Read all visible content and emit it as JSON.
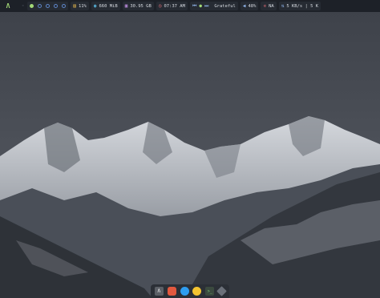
{
  "topbar": {
    "logo": "Λ",
    "workspace_count": 5,
    "active_workspace": 1,
    "separator": "◦",
    "cpu": "11%",
    "memory": "660 MiB",
    "disk": "30.95 GB",
    "time": "07:37 AM",
    "track": "Grateful",
    "volume": "48%",
    "network_status": "NA",
    "network_speed": "5 KB/s | 5 K"
  },
  "icons": {
    "cpu": "chip-icon",
    "memory": "memory-icon",
    "disk": "disk-icon",
    "clock": "clock-icon",
    "prev": "previous-track-icon",
    "play": "play-icon",
    "next": "next-track-icon",
    "volume": "speaker-icon",
    "network": "network-icon",
    "speed": "up-down-arrows-icon"
  },
  "dock": {
    "items": [
      "launcher",
      "files",
      "chat",
      "browser",
      "terminal",
      "settings"
    ],
    "launcher_glyph": "Λ",
    "terminal_glyph": ">_"
  },
  "colors": {
    "bar_bg": "#1d2128",
    "accent_green": "#a3d977",
    "accent_blue": "#5e86c9",
    "text": "#d6dae0"
  }
}
